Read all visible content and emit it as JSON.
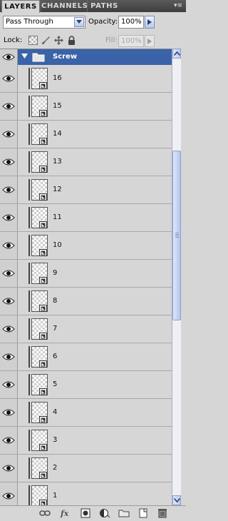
{
  "tabs": [
    {
      "label": "LAYERS",
      "active": true
    },
    {
      "label": "CHANNELS",
      "active": false
    },
    {
      "label": "PATHS",
      "active": false
    }
  ],
  "panel_menu_icon": "panel-menu-icon",
  "blend_mode": {
    "value": "Pass Through"
  },
  "opacity": {
    "label": "Opacity:",
    "value": "100%"
  },
  "lock": {
    "label": "Lock:",
    "icons": [
      "lock-transparent-pixels-icon",
      "lock-image-pixels-icon",
      "lock-position-icon",
      "lock-all-icon"
    ]
  },
  "fill": {
    "label": "Fill:",
    "value": "100%"
  },
  "group": {
    "name": "Screw",
    "expanded": true,
    "selected": true,
    "visible": true
  },
  "layers": [
    {
      "name": "16",
      "visible": true
    },
    {
      "name": "15",
      "visible": true
    },
    {
      "name": "14",
      "visible": true
    },
    {
      "name": "13",
      "visible": true
    },
    {
      "name": "12",
      "visible": true
    },
    {
      "name": "11",
      "visible": true
    },
    {
      "name": "10",
      "visible": true
    },
    {
      "name": "9",
      "visible": true
    },
    {
      "name": "8",
      "visible": true
    },
    {
      "name": "7",
      "visible": true
    },
    {
      "name": "6",
      "visible": true
    },
    {
      "name": "5",
      "visible": true
    },
    {
      "name": "4",
      "visible": true
    },
    {
      "name": "3",
      "visible": true
    },
    {
      "name": "2",
      "visible": true
    },
    {
      "name": "1",
      "visible": true
    }
  ],
  "toolbar_icons": [
    "link-layers-icon",
    "fx-icon",
    "add-mask-icon",
    "adjustment-layer-icon",
    "new-group-icon",
    "new-layer-icon",
    "trash-icon"
  ],
  "colors": {
    "selection": "#3a63a8",
    "panel": "#d6d6d6",
    "tab_bar": "#4a4a4a"
  }
}
